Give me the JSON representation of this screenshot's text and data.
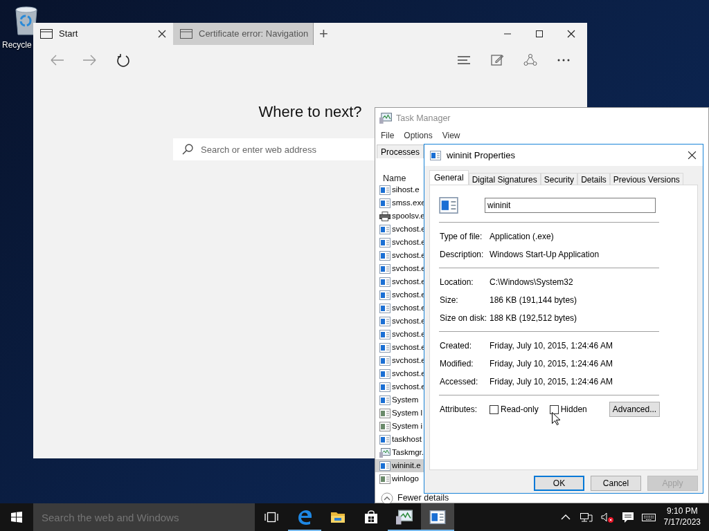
{
  "desktop": {
    "icons": [
      {
        "label": "Recycle"
      }
    ]
  },
  "browser": {
    "tabs": [
      {
        "title": "Start",
        "selected": true
      },
      {
        "title": "Certificate error: Navigation",
        "selected": false
      }
    ],
    "new_tab": "+",
    "heading": "Where to next?",
    "search": {
      "placeholder": "Search or enter web address"
    }
  },
  "task_manager": {
    "title": "Task Manager",
    "menu": [
      "File",
      "Options",
      "View"
    ],
    "tabs": [
      {
        "label": "Processes",
        "selected": true
      }
    ],
    "column": "Name",
    "rows": [
      {
        "name": "sihost.e",
        "kind": "app",
        "selected": false
      },
      {
        "name": "smss.exe",
        "kind": "app",
        "selected": false
      },
      {
        "name": "spoolsv.e",
        "kind": "printer",
        "selected": false
      },
      {
        "name": "svchost.e",
        "kind": "app",
        "selected": false
      },
      {
        "name": "svchost.e",
        "kind": "app",
        "selected": false
      },
      {
        "name": "svchost.e",
        "kind": "app",
        "selected": false
      },
      {
        "name": "svchost.e",
        "kind": "app",
        "selected": false
      },
      {
        "name": "svchost.e",
        "kind": "app",
        "selected": false
      },
      {
        "name": "svchost.e",
        "kind": "app",
        "selected": false
      },
      {
        "name": "svchost.e",
        "kind": "app",
        "selected": false
      },
      {
        "name": "svchost.e",
        "kind": "app",
        "selected": false
      },
      {
        "name": "svchost.e",
        "kind": "app",
        "selected": false
      },
      {
        "name": "svchost.e",
        "kind": "app",
        "selected": false
      },
      {
        "name": "svchost.e",
        "kind": "app",
        "selected": false
      },
      {
        "name": "svchost.e",
        "kind": "app",
        "selected": false
      },
      {
        "name": "svchost.e",
        "kind": "app",
        "selected": false
      },
      {
        "name": "System",
        "kind": "app",
        "selected": false
      },
      {
        "name": "System l",
        "kind": "service",
        "selected": false
      },
      {
        "name": "System i",
        "kind": "service",
        "selected": false
      },
      {
        "name": "taskhost",
        "kind": "app",
        "selected": false
      },
      {
        "name": "Taskmgr.",
        "kind": "monitor",
        "selected": false
      },
      {
        "name": "wininit.e",
        "kind": "app",
        "selected": true
      },
      {
        "name": "winlogo",
        "kind": "service",
        "selected": false
      }
    ],
    "footer": "Fewer details"
  },
  "dialog": {
    "title": "wininit Properties",
    "tabs": [
      {
        "label": "General",
        "selected": true
      },
      {
        "label": "Digital Signatures",
        "selected": false
      },
      {
        "label": "Security",
        "selected": false
      },
      {
        "label": "Details",
        "selected": false
      },
      {
        "label": "Previous Versions",
        "selected": false
      }
    ],
    "file_name": "wininit",
    "groups": [
      [
        {
          "label": "Type of file:",
          "value": "Application (.exe)"
        },
        {
          "label": "Description:",
          "value": "Windows Start-Up Application"
        }
      ],
      [
        {
          "label": "Location:",
          "value": "C:\\Windows\\System32"
        },
        {
          "label": "Size:",
          "value": "186 KB (191,144 bytes)"
        },
        {
          "label": "Size on disk:",
          "value": "188 KB (192,512 bytes)"
        }
      ],
      [
        {
          "label": "Created:",
          "value": "Friday, July 10, 2015, 1:24:46 AM"
        },
        {
          "label": "Modified:",
          "value": "Friday, July 10, 2015, 1:24:46 AM"
        },
        {
          "label": "Accessed:",
          "value": "Friday, July 10, 2015, 1:24:46 AM"
        }
      ]
    ],
    "attributes": {
      "label": "Attributes:",
      "options": [
        {
          "label": "Read-only",
          "checked": false
        },
        {
          "label": "Hidden",
          "checked": false
        }
      ],
      "advanced": "Advanced..."
    },
    "buttons": [
      {
        "label": "OK",
        "default": true,
        "disabled": false
      },
      {
        "label": "Cancel",
        "default": false,
        "disabled": false
      },
      {
        "label": "Apply",
        "default": false,
        "disabled": true
      }
    ]
  },
  "taskbar": {
    "search": {
      "placeholder": "Search the web and Windows"
    },
    "apps": [
      {
        "kind": "taskview",
        "running": false,
        "active": false
      },
      {
        "kind": "edge",
        "running": true,
        "active": false
      },
      {
        "kind": "explorer",
        "running": false,
        "active": false
      },
      {
        "kind": "store",
        "running": false,
        "active": false
      },
      {
        "kind": "taskmgr",
        "running": true,
        "active": false
      },
      {
        "kind": "properties",
        "running": true,
        "active": true
      }
    ],
    "time": "9:10 PM",
    "date": "7/17/2023"
  }
}
